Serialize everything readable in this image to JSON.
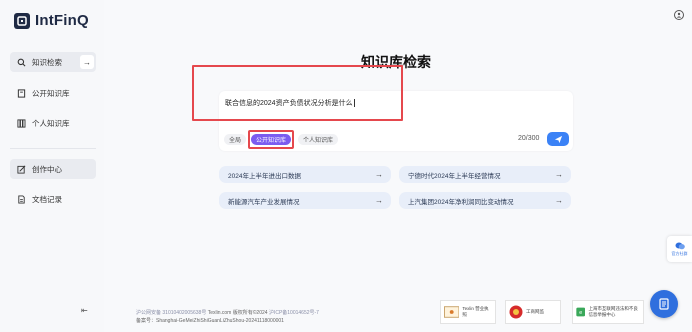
{
  "brand": {
    "name": "IntFinQ"
  },
  "sidebar": {
    "items": [
      {
        "label": "知识检索",
        "icon": "search-icon"
      },
      {
        "label": "公开知识库",
        "icon": "book-icon"
      },
      {
        "label": "个人知识库",
        "icon": "library-icon"
      },
      {
        "label": "创作中心",
        "icon": "edit-icon"
      },
      {
        "label": "文档记录",
        "icon": "document-icon"
      }
    ]
  },
  "main": {
    "title": "知识库检索",
    "query": "联合信息的2024资产负债状况分析是什么",
    "scopes": [
      "全局",
      "公开知识库",
      "个人知识库"
    ],
    "selected_scope": "公开知识库",
    "counter": "20/300",
    "suggestions": [
      "2024年上半年进出口数据",
      "宁德时代2024年上半年经营情况",
      "新能源汽车产业发展情况",
      "上汽集团2024年净利润同比变动情况"
    ]
  },
  "footer": {
    "line1_a": "沪公网安备 31010402005638号",
    "line1_b": "Texlin.com 版权所有©2024",
    "line1_c": "沪ICP备10014652号-7",
    "line2": "备案号：Shanghai-GeMeiZhiShiGuanLiZhuShou-20241118000001",
    "badge1": "Texlin 营业执照",
    "badge2": "工商网监",
    "badge3": "上海市互联网违法和不良信息举报中心"
  },
  "float": {
    "label": "官方社群"
  },
  "colors": {
    "accent": "#7b5cf0",
    "primary": "#2f6fde",
    "highlight": "#e5484d"
  }
}
